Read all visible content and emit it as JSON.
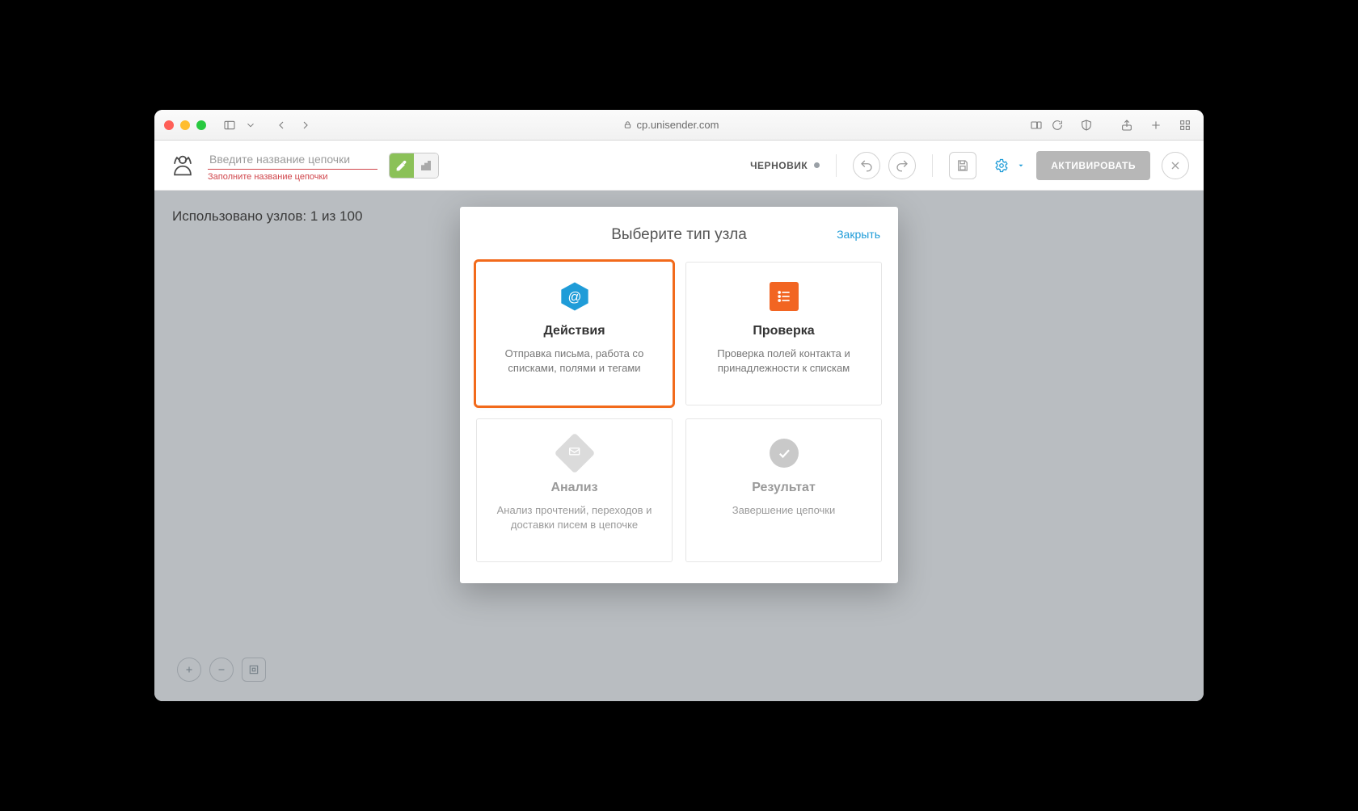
{
  "browser": {
    "url": "cp.unisender.com"
  },
  "header": {
    "name_placeholder": "Введите название цепочки",
    "name_error": "Заполните название цепочки",
    "status_label": "ЧЕРНОВИК",
    "activate_label": "АКТИВИРОВАТЬ"
  },
  "workspace": {
    "nodes_used": "Использовано узлов: 1 из 100"
  },
  "modal": {
    "title": "Выберите тип узла",
    "close": "Закрыть",
    "cards": [
      {
        "title": "Действия",
        "desc": "Отправка письма, работа со списками, полями и тегами",
        "icon": "at-hex",
        "state": "selected"
      },
      {
        "title": "Проверка",
        "desc": "Проверка полей контакта и принадлежности к спискам",
        "icon": "list-sq",
        "state": "normal"
      },
      {
        "title": "Анализ",
        "desc": "Анализ прочтений, переходов и доставки писем в цепочке",
        "icon": "mail-dia",
        "state": "disabled"
      },
      {
        "title": "Результат",
        "desc": "Завершение цепочки",
        "icon": "check-ci",
        "state": "disabled"
      }
    ]
  }
}
